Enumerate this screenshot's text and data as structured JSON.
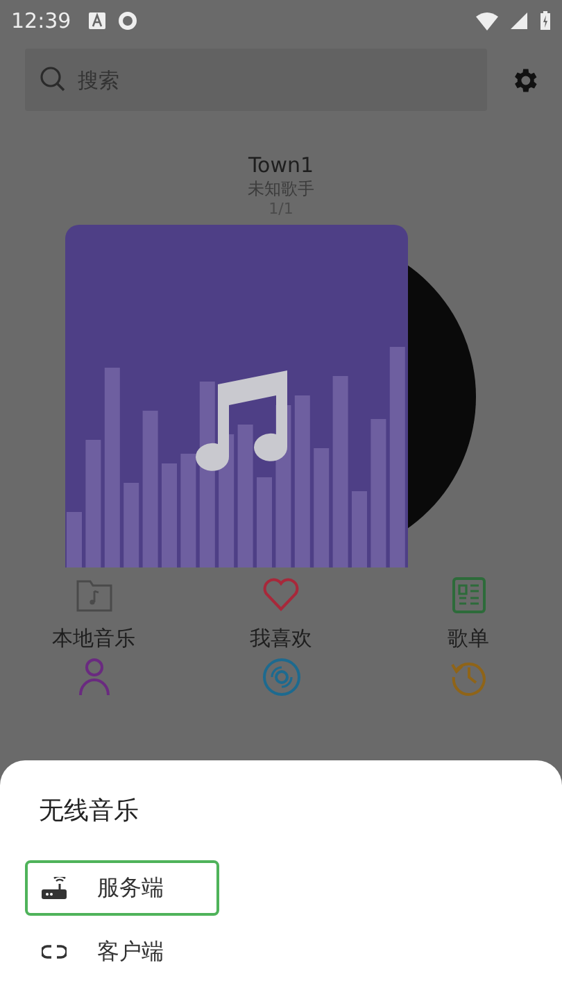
{
  "status_bar": {
    "time": "12:39"
  },
  "search": {
    "placeholder": "搜索"
  },
  "now_playing": {
    "title": "Town1",
    "artist": "未知歌手",
    "position": "1/1"
  },
  "shortcuts": [
    {
      "kind": "folder",
      "label": "本地音乐"
    },
    {
      "kind": "heart",
      "label": "我喜欢"
    },
    {
      "kind": "list",
      "label": "歌单"
    },
    {
      "kind": "person"
    },
    {
      "kind": "disc"
    },
    {
      "kind": "history"
    }
  ],
  "sheet": {
    "title": "无线音乐",
    "options": [
      {
        "kind": "router",
        "label": "服务端",
        "selected": true
      },
      {
        "kind": "link",
        "label": "客户端",
        "selected": false
      }
    ]
  }
}
